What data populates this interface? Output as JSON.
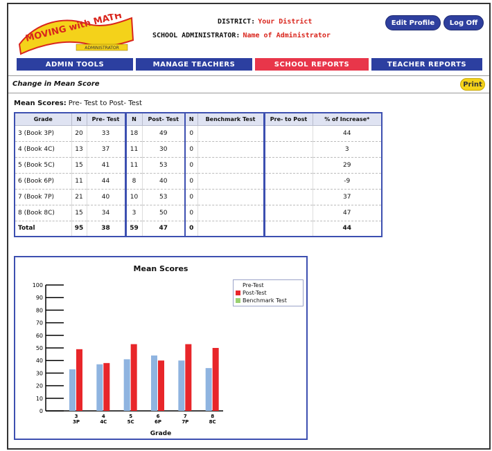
{
  "header": {
    "logo_text": "MOVING with MATH",
    "logo_subtext": "ADMINISTRATOR",
    "district_label": "DISTRICT:",
    "district_value": "Your District",
    "admin_label": "SCHOOL ADMINISTRATOR:",
    "admin_value": "Name of Administrator",
    "edit_profile": "Edit Profile",
    "log_off": "Log Off"
  },
  "nav": [
    {
      "label": "ADMIN TOOLS"
    },
    {
      "label": "MANAGE TEACHERS"
    },
    {
      "label": "SCHOOL REPORTS"
    },
    {
      "label": "TEACHER REPORTS"
    }
  ],
  "page": {
    "title": "Change in Mean Score",
    "print": "Print",
    "subtitle_label": "Mean Scores:",
    "subtitle_value": "Pre- Test to Post- Test"
  },
  "table": {
    "headers": [
      "Grade",
      "N",
      "Pre- Test",
      "N",
      "Post- Test",
      "N",
      "Benchmark Test",
      "Pre- to Post",
      "% of Increase*"
    ],
    "rows": [
      [
        "3 (Book 3P)",
        "20",
        "33",
        "18",
        "49",
        "0",
        "",
        "",
        "44"
      ],
      [
        "4 (Book 4C)",
        "13",
        "37",
        "11",
        "30",
        "0",
        "",
        "",
        "3"
      ],
      [
        "5 (Book 5C)",
        "15",
        "41",
        "11",
        "53",
        "0",
        "",
        "",
        "29"
      ],
      [
        "6 (Book 6P)",
        "11",
        "44",
        "8",
        "40",
        "0",
        "",
        "",
        "-9"
      ],
      [
        "7 (Book 7P)",
        "21",
        "40",
        "10",
        "53",
        "0",
        "",
        "",
        "37"
      ],
      [
        "8 (Book 8C)",
        "15",
        "34",
        "3",
        "50",
        "0",
        "",
        "",
        "47"
      ],
      [
        "Total",
        "95",
        "38",
        "59",
        "47",
        "0",
        "",
        "",
        "44"
      ]
    ]
  },
  "chart_data": {
    "type": "bar",
    "title": "Mean Scores",
    "xlabel": "Grade",
    "ylabel": "",
    "ylim": [
      0,
      100
    ],
    "yticks": [
      "0",
      "10",
      "20",
      "30",
      "40",
      "50",
      "60",
      "70",
      "80",
      "90",
      "100"
    ],
    "categories": [
      "3 3P",
      "4 4C",
      "5 5C",
      "6 6P",
      "7 7P",
      "8 8C"
    ],
    "category_lines": [
      [
        "3",
        "3P"
      ],
      [
        "4",
        "4C"
      ],
      [
        "5",
        "5C"
      ],
      [
        "6",
        "6P"
      ],
      [
        "7",
        "7P"
      ],
      [
        "8",
        "8C"
      ]
    ],
    "series": [
      {
        "name": "Pre-Test",
        "color": "#8fb4e0",
        "values": [
          33,
          37,
          41,
          44,
          40,
          34
        ]
      },
      {
        "name": "Post-Test",
        "color": "#e8262a",
        "values": [
          49,
          38,
          53,
          40,
          53,
          50
        ]
      },
      {
        "name": "Benchmark Test",
        "color": "#9ad070",
        "values": [
          0,
          0,
          0,
          0,
          0,
          0
        ]
      }
    ],
    "legend_position": "top-right",
    "grid": false
  }
}
